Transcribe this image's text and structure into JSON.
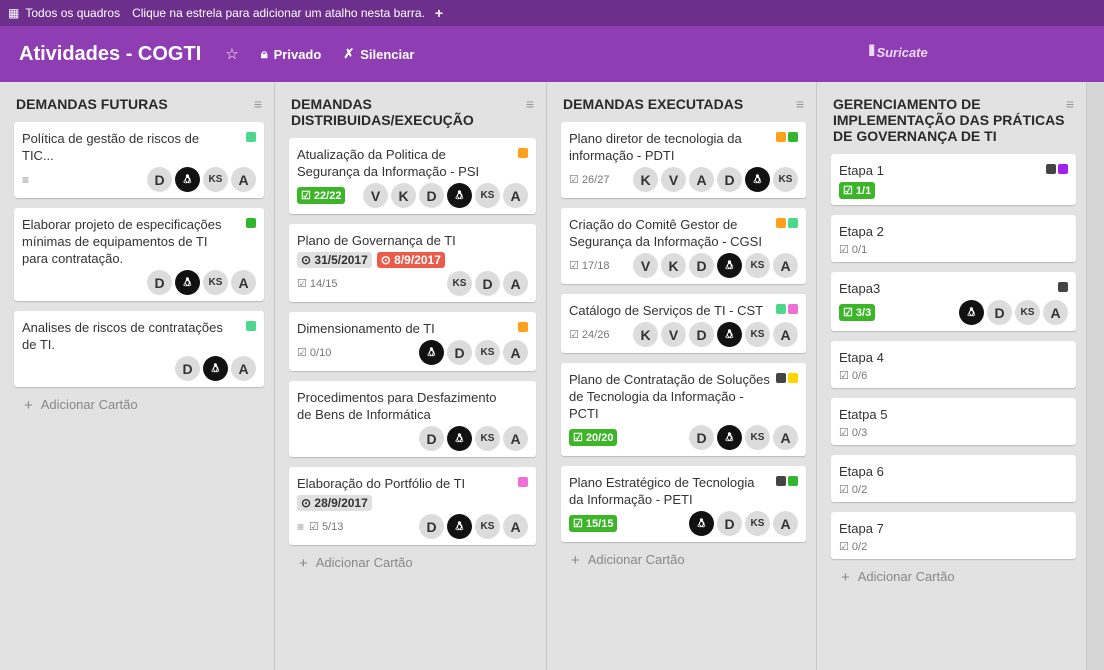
{
  "topbar": {
    "all_boards": "Todos os quadros",
    "hint": "Clique na estrela para adicionar um atalho nesta barra.",
    "plus": "+"
  },
  "header": {
    "title": "Atividades - COGTI",
    "privacy": "Privado",
    "mute": "Silenciar",
    "logo_text": "Suricate"
  },
  "add_card_label": "Adicionar Cartão",
  "label_colors": {
    "green": "#4bd78c",
    "dgreen": "#32b62f",
    "orange": "#ff9f1a",
    "pink": "#f06fd6",
    "dark": "#444444",
    "purple": "#a020f0",
    "yellow": "#ffd500"
  },
  "lists": [
    {
      "title": "DEMANDAS FUTURAS",
      "cards": [
        {
          "title": "Política de gestão de riscos de TIC...",
          "labels": [
            "green"
          ],
          "desc": true,
          "members": [
            "D",
            "P",
            "KS",
            "A"
          ]
        },
        {
          "title": "Elaborar projeto de especificações mínimas de equipamentos de TI para contratação.",
          "labels": [
            "dgreen"
          ],
          "members": [
            "D",
            "P",
            "KS",
            "A"
          ]
        },
        {
          "title": "Analises de riscos de contratações de TI.",
          "labels": [
            "green"
          ],
          "members": [
            "D",
            "P",
            "A"
          ]
        }
      ]
    },
    {
      "title": "DEMANDAS DISTRIBUIDAS/EXECUÇÃO",
      "cards": [
        {
          "title": "Atualização da Politica de Segurança da Informação - PSI",
          "labels": [
            "orange"
          ],
          "members": [
            "V",
            "K",
            "D",
            "P",
            "KS",
            "A"
          ],
          "checklist_done": "22/22"
        },
        {
          "title": "Plano de Governança de TI",
          "labels": [],
          "start": "31/5/2017",
          "due": "8/9/2017",
          "checklist": "14/15",
          "members": [
            "KS",
            "D",
            "A"
          ]
        },
        {
          "title": "Dimensionamento de TI",
          "labels": [
            "orange"
          ],
          "checklist": "0/10",
          "members": [
            "P",
            "D",
            "KS",
            "A"
          ]
        },
        {
          "title": "Procedimentos para Desfazimento de Bens de Informática",
          "labels": [],
          "members": [
            "D",
            "P",
            "KS",
            "A"
          ]
        },
        {
          "title": "Elaboração do Portfólio de TI",
          "labels": [
            "pink"
          ],
          "start": "28/9/2017",
          "desc": true,
          "checklist": "5/13",
          "members": [
            "D",
            "P",
            "KS",
            "A"
          ]
        }
      ]
    },
    {
      "title": "DEMANDAS EXECUTADAS",
      "cards": [
        {
          "title": "Plano diretor de tecnologia da informação - PDTI",
          "labels": [
            "orange",
            "dgreen"
          ],
          "checklist": "26/27",
          "members": [
            "K",
            "V",
            "A",
            "D",
            "P",
            "KS"
          ]
        },
        {
          "title": "Criação do Comitê Gestor de Segurança da Informação - CGSI",
          "labels": [
            "orange",
            "green"
          ],
          "checklist": "17/18",
          "members": [
            "V",
            "K",
            "D",
            "P",
            "KS",
            "A"
          ]
        },
        {
          "title": "Catálogo de Serviços de TI - CST",
          "labels": [
            "green",
            "pink"
          ],
          "checklist": "24/26",
          "members": [
            "K",
            "V",
            "D",
            "P",
            "KS",
            "A"
          ]
        },
        {
          "title": "Plano de Contratação de Soluções de Tecnologia da Informação - PCTI",
          "labels": [
            "dark",
            "yellow"
          ],
          "checklist_done": "20/20",
          "members": [
            "D",
            "P",
            "KS",
            "A"
          ]
        },
        {
          "title": "Plano Estratégico de Tecnologia da Informação - PETI",
          "labels": [
            "dark",
            "dgreen"
          ],
          "checklist_done": "15/15",
          "members": [
            "P",
            "D",
            "KS",
            "A"
          ]
        }
      ]
    },
    {
      "title": "GERENCIAMENTO DE IMPLEMENTAÇÃO DAS PRÁTICAS DE GOVERNANÇA DE TI",
      "cards": [
        {
          "title": "Etapa 1",
          "labels": [
            "dark",
            "purple"
          ],
          "checklist_done": "1/1"
        },
        {
          "title": "Etapa 2",
          "labels": [],
          "checklist": "0/1"
        },
        {
          "title": "Etapa3",
          "labels": [
            "dark"
          ],
          "checklist_done": "3/3",
          "members": [
            "P",
            "D",
            "KS",
            "A"
          ]
        },
        {
          "title": "Etapa 4",
          "labels": [],
          "checklist": "0/6"
        },
        {
          "title": "Etatpa 5",
          "labels": [],
          "checklist": "0/3"
        },
        {
          "title": "Etapa 6",
          "labels": [],
          "checklist": "0/2"
        },
        {
          "title": "Etapa 7",
          "labels": [],
          "checklist": "0/2"
        }
      ]
    }
  ]
}
